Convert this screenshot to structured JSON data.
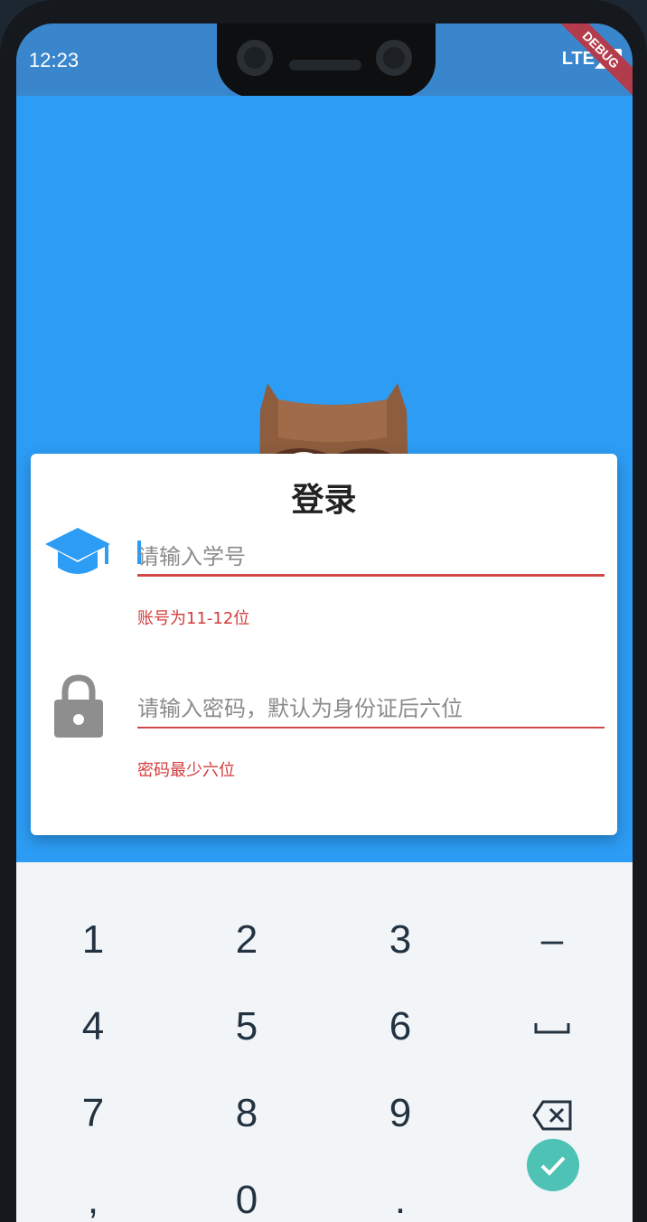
{
  "status_bar": {
    "time": "12:23",
    "network": "LTE"
  },
  "debug_banner": "DEBUG",
  "login": {
    "title": "登录",
    "username_placeholder": "请输入学号",
    "username_error": "账号为11-12位",
    "password_placeholder": "请输入密码，默认为身份证后六位",
    "password_error": "密码最少六位"
  },
  "keypad": {
    "keys": [
      "1",
      "2",
      "3",
      "–",
      "4",
      "5",
      "6",
      "␣",
      "7",
      "8",
      "9",
      "⌫",
      ",",
      "0",
      ".",
      "✓"
    ]
  },
  "colors": {
    "primary": "#2c9cf4",
    "error": "#d33c3c",
    "accent_confirm": "#4ec2b5"
  }
}
